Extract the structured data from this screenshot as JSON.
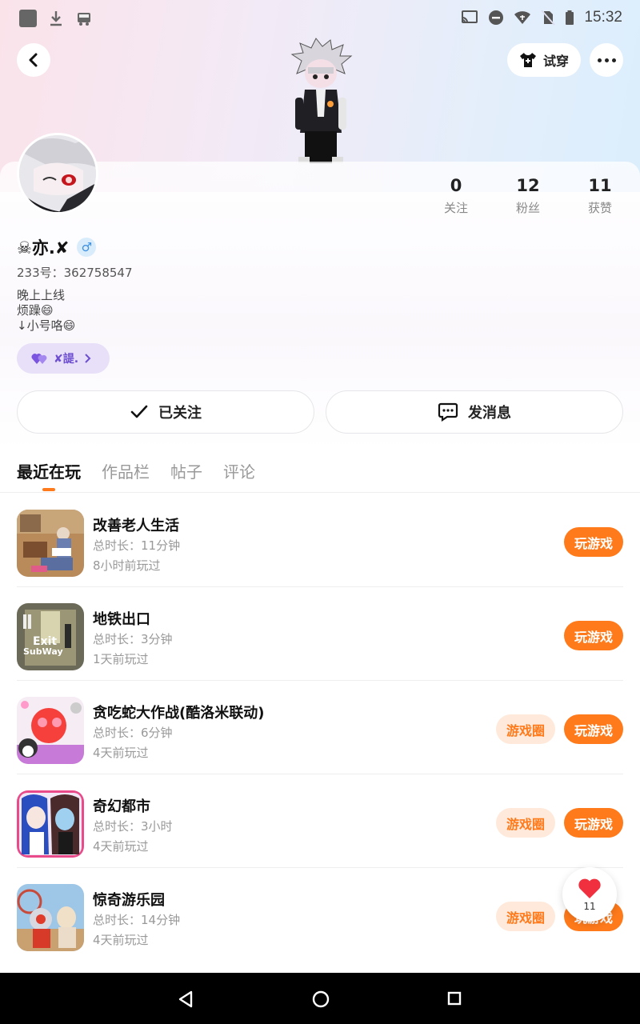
{
  "status_bar": {
    "time": "15:32",
    "left_icons": [
      "app-square-icon",
      "download-icon",
      "car-icon"
    ],
    "right_icons": [
      "cast-icon",
      "dnd-icon",
      "wifi-icon",
      "no-sim-icon",
      "battery-icon"
    ]
  },
  "header": {
    "tryon_label": "试穿"
  },
  "profile": {
    "username": "☠亦.✘",
    "gender_symbol": "♂",
    "uid": "233号：362758547",
    "bio": [
      "晚上上线",
      "烦躁😄",
      "↓小号咯😄"
    ],
    "couple_chip_label": "✘諟.",
    "stats": [
      {
        "value": "0",
        "label": "关注"
      },
      {
        "value": "12",
        "label": "粉丝"
      },
      {
        "value": "11",
        "label": "获赞"
      }
    ],
    "follow_label": "已关注",
    "message_label": "发消息"
  },
  "tabs": [
    {
      "label": "最近在玩",
      "active": true
    },
    {
      "label": "作品栏",
      "active": false
    },
    {
      "label": "帖子",
      "active": false
    },
    {
      "label": "评论",
      "active": false
    }
  ],
  "games": [
    {
      "name": "改善老人生活",
      "duration": "总时长：11分钟",
      "last_played": "8小时前玩过",
      "has_circle": false,
      "play_label": "玩游戏",
      "circle_label": "游戏圈"
    },
    {
      "name": "地铁出口",
      "duration": "总时长：3分钟",
      "last_played": "1天前玩过",
      "has_circle": false,
      "play_label": "玩游戏",
      "circle_label": "游戏圈",
      "thumb_text": [
        "Exit",
        "SubWay"
      ]
    },
    {
      "name": "贪吃蛇大作战(酷洛米联动)",
      "duration": "总时长：6分钟",
      "last_played": "4天前玩过",
      "has_circle": true,
      "play_label": "玩游戏",
      "circle_label": "游戏圈"
    },
    {
      "name": "奇幻都市",
      "duration": "总时长：3小时",
      "last_played": "4天前玩过",
      "has_circle": true,
      "play_label": "玩游戏",
      "circle_label": "游戏圈"
    },
    {
      "name": "惊奇游乐园",
      "duration": "总时长：14分钟",
      "last_played": "4天前玩过",
      "has_circle": true,
      "play_label": "玩游戏",
      "circle_label": "游戏圈"
    }
  ],
  "like_fab": {
    "count": "11"
  },
  "colors": {
    "accent": "#ff7a1a",
    "accent_light": "#ffe9db",
    "chip_bg": "#e7e0f8",
    "chip_text": "#6e4fd1"
  }
}
